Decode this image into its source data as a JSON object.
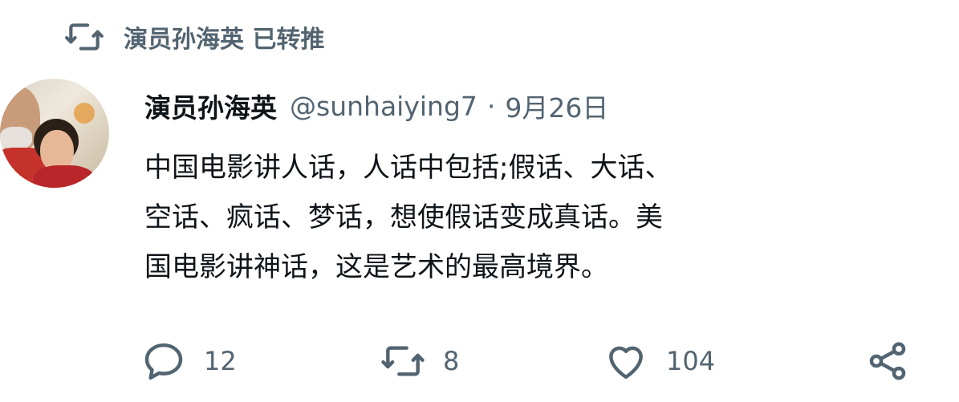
{
  "retweet_header": {
    "text": "演员孙海英 已转推"
  },
  "tweet": {
    "display_name": "演员孙海英",
    "handle": "@sunhaiying7",
    "separator": "·",
    "date": "9月26日",
    "lines": [
      "中国电影讲人话，人话中包括;假话、大话、",
      "空话、疯话、梦话，想使假话变成真话。美",
      "国电影讲神话，这是艺术的最高境界。"
    ]
  },
  "actions": {
    "reply_count": "12",
    "retweet_count": "8",
    "like_count": "104"
  },
  "icons": [
    "retweet-icon",
    "reply-icon",
    "retweet-icon",
    "heart-icon",
    "share-icon"
  ]
}
